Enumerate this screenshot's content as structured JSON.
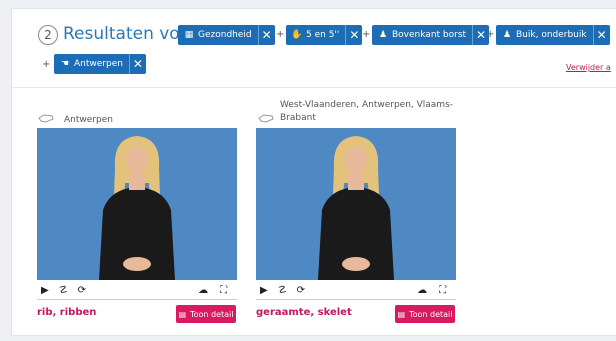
{
  "header": {
    "step": "2",
    "title": "Resultaten voor:"
  },
  "filters": [
    {
      "icon": "grid-icon",
      "label": "Gezondheid"
    },
    {
      "icon": "hand-icon",
      "label": "5 en 5''"
    },
    {
      "icon": "person-icon",
      "label": "Bovenkant borst"
    },
    {
      "icon": "person-icon",
      "label": "Buik, onderbuik"
    },
    {
      "icon": "hands-icon",
      "label": "Antwerpen"
    }
  ],
  "plus": "+",
  "close_glyph": "✕",
  "remove_all": "Verwijder a",
  "results": [
    {
      "region": "Antwerpen",
      "word": "rib, ribben",
      "detail": "Toon detail"
    },
    {
      "region": "West-Vlaanderen, Antwerpen, Vlaams-Brabant",
      "word": "geraamte, skelet",
      "detail": "Toon detail"
    }
  ]
}
